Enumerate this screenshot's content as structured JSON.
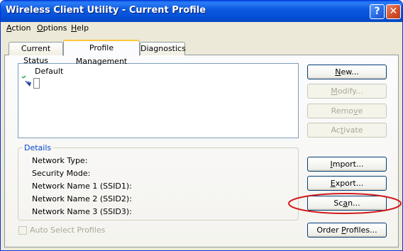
{
  "window": {
    "title": "Wireless Client Utility - Current Profile",
    "help_glyph": "?",
    "close_glyph": "✕"
  },
  "menu": [
    {
      "u": "A",
      "rest": "ction"
    },
    {
      "u": "O",
      "rest": "ptions"
    },
    {
      "u": "H",
      "rest": "elp"
    }
  ],
  "tabs": [
    "Current Status",
    "Profile Management",
    "Diagnostics"
  ],
  "active_tab": "Profile Management",
  "profiles": [
    {
      "name": "Default",
      "icon": "network-profile-icon"
    }
  ],
  "details": {
    "legend": "Details",
    "labels": [
      "Network Type:",
      "Security Mode:",
      "Network Name 1 (SSID1):",
      "Network Name 2 (SSID2):",
      "Network Name 3 (SSID3):"
    ]
  },
  "buttons": {
    "new": {
      "u": "N",
      "rest": "ew..."
    },
    "modify": {
      "u": "M",
      "rest": "odify..."
    },
    "remove": {
      "pre": "Remo",
      "u": "v",
      "rest": "e"
    },
    "activate": {
      "pre": "Ac",
      "u": "t",
      "rest": "ivate"
    },
    "import": {
      "u": "I",
      "rest": "mport..."
    },
    "export": {
      "u": "E",
      "rest": "xport..."
    },
    "scan": {
      "pre": "Sc",
      "u": "a",
      "rest": "n..."
    },
    "order_profiles": {
      "pre": "Order ",
      "u": "P",
      "rest": "rofiles..."
    }
  },
  "auto_select": {
    "label": "Auto Select Profiles",
    "checked": false,
    "enabled": false
  },
  "colors": {
    "highlight": "#d11a1a",
    "title_bar": "#0a5fe8",
    "group_label": "#0046d5"
  }
}
